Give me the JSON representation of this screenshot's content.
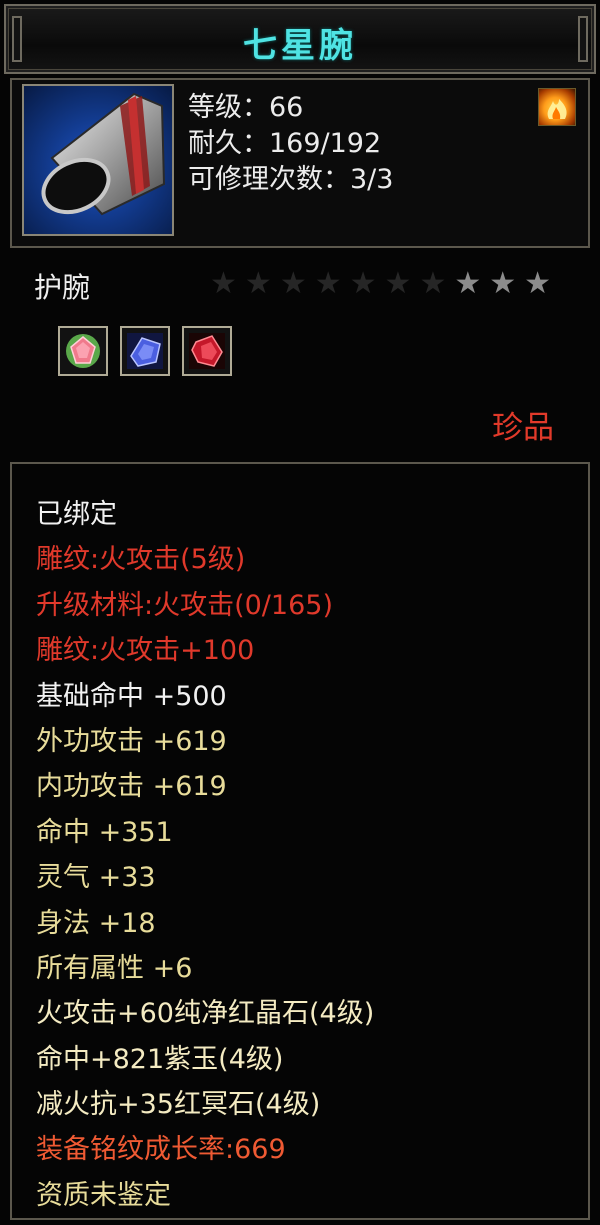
{
  "title": "七星腕",
  "stats": [
    {
      "label": "等级",
      "value": "66"
    },
    {
      "label": "耐久",
      "value": "169/192"
    },
    {
      "label": "可修理次数",
      "value": "3/3"
    }
  ],
  "separator": "：",
  "item_type": "护腕",
  "stars": {
    "total": 10,
    "lit": 3
  },
  "rarity": "珍品",
  "icons": {
    "item": "bracer-icon",
    "badge": "flame-badge-icon",
    "gems": [
      "pink-gem-icon",
      "purple-gem-icon",
      "red-gem-icon"
    ]
  },
  "colors": {
    "title": "#4fe3e3",
    "red": "#e0392b",
    "yellow": "#e8dc9a",
    "white": "#f2f2f2",
    "orange": "#ef5a33"
  },
  "attributes": [
    {
      "text": "已绑定",
      "color": "white"
    },
    {
      "text": "雕纹:火攻击(5级)",
      "color": "red"
    },
    {
      "text": "升级材料:火攻击(0/165)",
      "color": "red"
    },
    {
      "text": "雕纹:火攻击+100",
      "color": "red"
    },
    {
      "text": "基础命中  +500",
      "color": "white"
    },
    {
      "text": "外功攻击  +619",
      "color": "yellow"
    },
    {
      "text": "内功攻击  +619",
      "color": "yellow"
    },
    {
      "text": "命中  +351",
      "color": "yellow"
    },
    {
      "text": "灵气  +33",
      "color": "yellow"
    },
    {
      "text": "身法  +18",
      "color": "yellow"
    },
    {
      "text": "所有属性  +6",
      "color": "yellow"
    },
    {
      "text": "火攻击+60纯净红晶石(4级)",
      "color": "gem"
    },
    {
      "text": "命中+821紫玉(4级)",
      "color": "gem"
    },
    {
      "text": "减火抗+35红冥石(4级)",
      "color": "gem"
    },
    {
      "text": "装备铭纹成长率:669",
      "color": "orange"
    },
    {
      "text": "资质未鉴定",
      "color": "yellow"
    }
  ]
}
